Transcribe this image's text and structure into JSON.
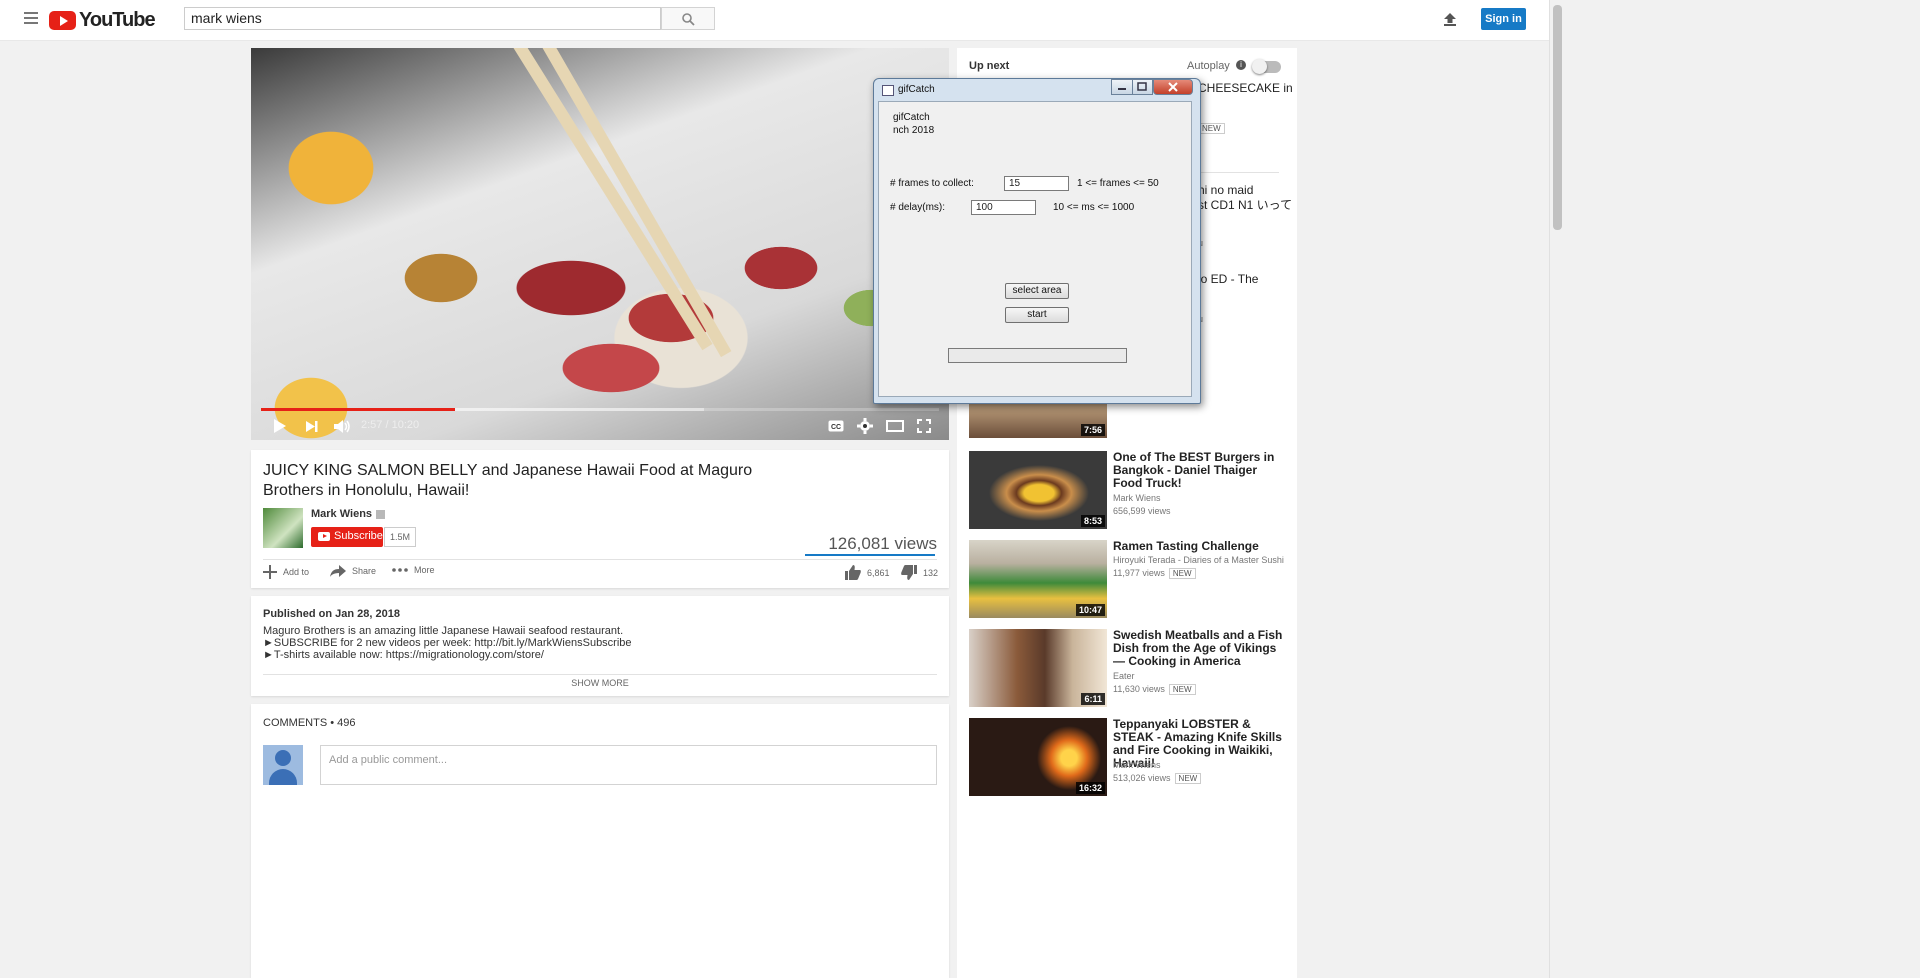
{
  "header": {
    "logo_text": "YouTube",
    "search_value": "mark wiens",
    "signin_label": "Sign in"
  },
  "player": {
    "time": "2:57 / 10:20",
    "progress_played": 0.2855,
    "progress_loaded": 0.6531
  },
  "video": {
    "title": "JUICY KING SALMON BELLY and Japanese Hawaii Food at Maguro Brothers in Honolulu, Hawaii!",
    "channel": "Mark Wiens",
    "subscribe_label": "Subscribe",
    "subscriber_count": "1.5M",
    "views": "126,081 views",
    "actions": {
      "add_to": "Add to",
      "share": "Share",
      "more": "More"
    },
    "likes": "6,861",
    "dislikes": "132"
  },
  "description": {
    "published": "Published on Jan 28, 2018",
    "lines": [
      "Maguro Brothers is an amazing little Japanese Hawaii seafood restaurant.",
      "►SUBSCRIBE for 2 new videos per week: http://bit.ly/MarkWiensSubscribe",
      "►T-shirts available now: https://migrationology.com/store/"
    ],
    "show_more": "SHOW MORE"
  },
  "comments": {
    "title": "COMMENTS • 496",
    "placeholder": "Add a public comment..."
  },
  "sidebar": {
    "up_next": "Up next",
    "autoplay": "Autoplay",
    "partials": {
      "p1_line1": "CHEESECAKE in",
      "p1_meta": "u",
      "p1_badge": "NEW",
      "p2_line1": "hi no maid",
      "p2_line2": "st CD1 N1 いって",
      "p2_meta": "u",
      "p3_line1": "io ED - The",
      "p3_meta": "u"
    },
    "partial_duration": "7:56",
    "videos": [
      {
        "title": "One of The BEST Burgers in Bangkok - Daniel Thaiger Food Truck!",
        "channel": "Mark Wiens",
        "views": "656,599 views",
        "badge": "",
        "duration": "8:53"
      },
      {
        "title": "Ramen Tasting Challenge",
        "channel": "Hiroyuki Terada - Diaries of a Master Sushi",
        "views": "11,977 views",
        "badge": "NEW",
        "duration": "10:47"
      },
      {
        "title": "Swedish Meatballs and a Fish Dish from the Age of Vikings — Cooking in America",
        "channel": "Eater",
        "views": "11,630 views",
        "badge": "NEW",
        "duration": "6:11"
      },
      {
        "title": "Teppanyaki LOBSTER & STEAK - Amazing Knife Skills and Fire Cooking in Waikiki, Hawaii!",
        "channel": "Mark Wiens",
        "views": "513,026 views",
        "badge": "NEW",
        "duration": "16:32"
      }
    ]
  },
  "gifcatch": {
    "title": "gifCatch",
    "about_line1": "gifCatch",
    "about_line2": "nch 2018",
    "frames_label": "# frames to collect:",
    "frames_value": "15",
    "frames_hint": "1 <= frames <= 50",
    "delay_label": "# delay(ms):",
    "delay_value": "100",
    "delay_hint": "10 <= ms <= 1000",
    "select_area_label": "select area",
    "start_label": "start"
  }
}
